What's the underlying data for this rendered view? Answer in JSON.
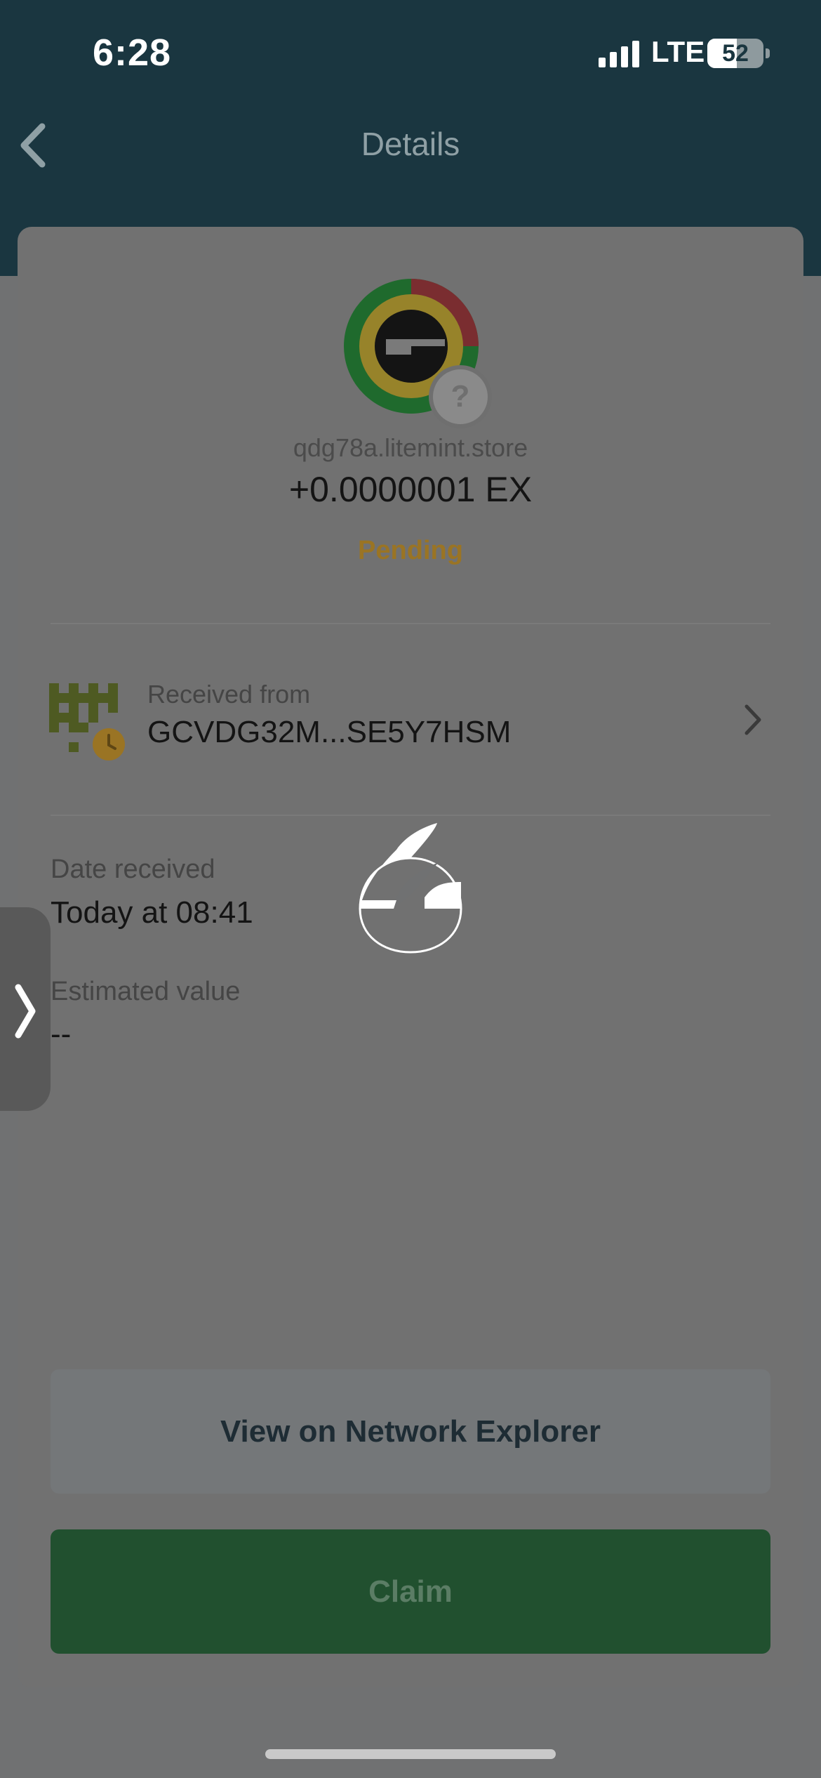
{
  "status_bar": {
    "time": "6:28",
    "network": "LTE",
    "battery_percent": "52",
    "battery_level": 0.52
  },
  "header": {
    "title": "Details"
  },
  "transaction": {
    "domain": "qdg78a.litemint.store",
    "amount": "+0.0000001 EX",
    "status": "Pending",
    "received_from_label": "Received from",
    "received_from_address": "GCVDG32M...SE5Y7HSM",
    "date_label": "Date received",
    "date_value": "Today at 08:41",
    "estimated_value_label": "Estimated value",
    "estimated_value": "--"
  },
  "actions": {
    "explorer_label": "View on Network Explorer",
    "claim_label": "Claim"
  },
  "colors": {
    "header_bg": "#1a3640",
    "pending": "#9a7424",
    "claim_button": "#21502f"
  },
  "icons": {
    "back": "chevron-left-icon",
    "token_logo": "token-logo-icon",
    "unknown_badge": "question-mark-icon",
    "sender": "identicon-icon",
    "clock": "clock-icon",
    "row": "chevron-right-icon",
    "loading": "spinner-icon",
    "side_tab": "chevron-right-icon"
  }
}
